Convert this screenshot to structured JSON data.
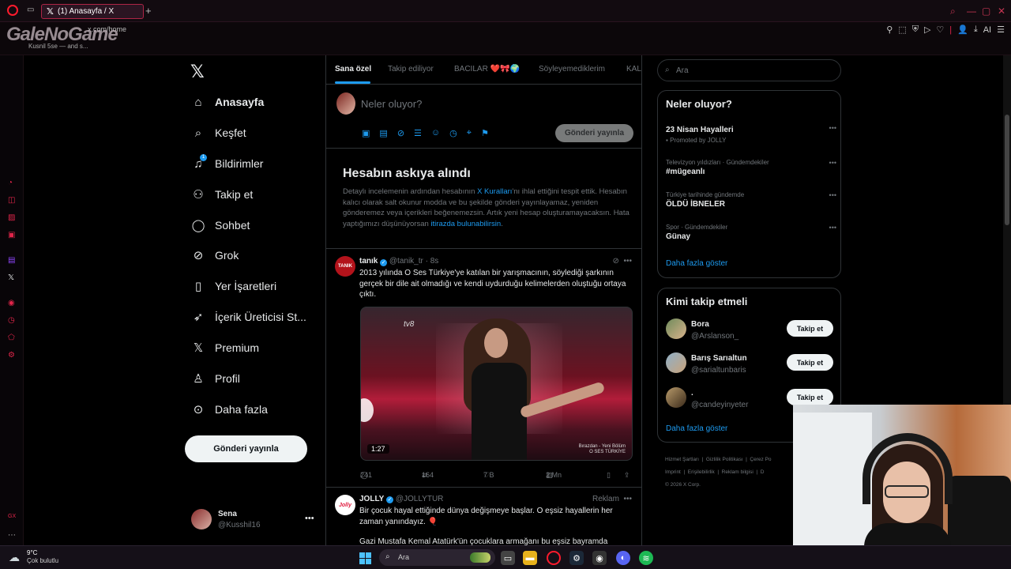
{
  "browser": {
    "tab_title": "(1) Anasayfa / X",
    "new_tab": "+",
    "url": "x.com/home",
    "tooltip": "Kusnil 5se — and s...",
    "logo_overlay": "GaleNoGame",
    "ext_ai": "AI"
  },
  "nav": {
    "items": [
      {
        "label": "Anasayfa",
        "icon": "home-icon"
      },
      {
        "label": "Keşfet",
        "icon": "search-icon"
      },
      {
        "label": "Bildirimler",
        "icon": "bell-icon"
      },
      {
        "label": "Takip et",
        "icon": "add-user-icon"
      },
      {
        "label": "Sohbet",
        "icon": "chat-icon"
      },
      {
        "label": "Grok",
        "icon": "grok-icon"
      },
      {
        "label": "Yer İşaretleri",
        "icon": "bookmark-icon"
      },
      {
        "label": "İçerik Üreticisi St...",
        "icon": "rocket-icon"
      },
      {
        "label": "Premium",
        "icon": "x-icon"
      },
      {
        "label": "Profil",
        "icon": "person-icon"
      },
      {
        "label": "Daha fazla",
        "icon": "more-circle-icon"
      }
    ],
    "notification_count": "1",
    "post_button": "Gönderi yayınla",
    "user": {
      "name": "Sena",
      "handle": "@Kusshil16"
    }
  },
  "timeline": {
    "tabs": [
      "Sana özel",
      "Takip ediliyor",
      "BACILAR ❤️🎀🌍",
      "Söyleyemediklerim",
      "KAL"
    ],
    "compose_placeholder": "Neler oluyor?",
    "compose_button": "Gönderi yayınla",
    "suspension": {
      "title": "Hesabın askıya alındı",
      "text_1": "Detaylı incelemenin ardından hesabının ",
      "link_1": "X Kuralları",
      "text_2": "'nı ihlal ettiğini tespit ettik. Hesabın kalıcı olarak salt okunur modda ve bu şekilde gönderi yayınlayamaz, yeniden gönderemez veya içerikleri beğenemezsin. Artık yeni hesap oluşturamayacaksın. Hata yaptığımızı düşünüyorsan ",
      "link_2": "itirazda bulunabilirsin",
      "text_3": "."
    },
    "tweet": {
      "avatar_text": "TANIK",
      "name": "tanık",
      "handle": "@tanik_tr",
      "time": "· 8s",
      "text": "2013 yılında O Ses Türkiye'ye katılan bir yarışmacının, söylediği şarkının gerçek bir dile ait olmadığı ve kendi uydurduğu kelimelerden oluştuğu ortaya çıktı.",
      "media_logo": "tv8",
      "media_watermark_1": "Bırazdan - Yeni Bölüm",
      "media_watermark_2": "O SES TÜRKİYE",
      "duration": "1:27",
      "replies": "241",
      "retweets": "164",
      "likes": "7 B",
      "views": "2 Mn"
    },
    "ad": {
      "avatar_text": "Jolly",
      "name": "JOLLY",
      "handle": "@JOLLYTUR",
      "label": "Reklam",
      "text": "Bir çocuk hayal ettiğinde dünya değişmeye başlar. O eşsiz hayallerin her zaman yanındayız. 🎈",
      "text_2": "Gazi Mustafa Kemal Atatürk'ün çocuklara armağanı bu eşsiz bayramda"
    }
  },
  "sidebar": {
    "search_placeholder": "Ara",
    "trends_title": "Neler oluyor?",
    "trends": [
      {
        "context": "",
        "title": "23 Nisan Hayalleri",
        "promo": "Promoted by JOLLY"
      },
      {
        "context": "Televizyon yıldızları · Gündemdekiler",
        "title": "#mügeanlı",
        "promo": ""
      },
      {
        "context": "Türkiye tarihinde gündemde",
        "title": "ÖLDÜ İBNELER",
        "promo": ""
      },
      {
        "context": "Spor · Gündemdekiler",
        "title": "Günay",
        "promo": ""
      }
    ],
    "trends_more": "Daha fazla göster",
    "who_title": "Kimi takip etmeli",
    "who": [
      {
        "name": "Bora",
        "handle": "@Arslanson_",
        "button": "Takip et"
      },
      {
        "name": "Barış Sarıaltun",
        "handle": "@sarialtunbaris",
        "button": "Takip et"
      },
      {
        "name": ".",
        "handle": "@candeyinyeter",
        "button": "Takip et"
      }
    ],
    "who_more": "Daha fazla göster",
    "footer": {
      "l1": "Hizmet Şartları",
      "l2": "Gizlilik Politikası",
      "l3": "Çerez Po",
      "l4": "Imprint",
      "l5": "Erişilebilirlik",
      "l6": "Reklam bilgisi",
      "l7": "D",
      "copyright": "© 2026 X Corp."
    }
  },
  "taskbar": {
    "temp": "9°C",
    "weather": "Çok bulutlu",
    "search_placeholder": "Ara"
  },
  "colors": {
    "accent": "#1d9bf0",
    "opera_red": "#ff1b2d",
    "background": "#000000"
  }
}
